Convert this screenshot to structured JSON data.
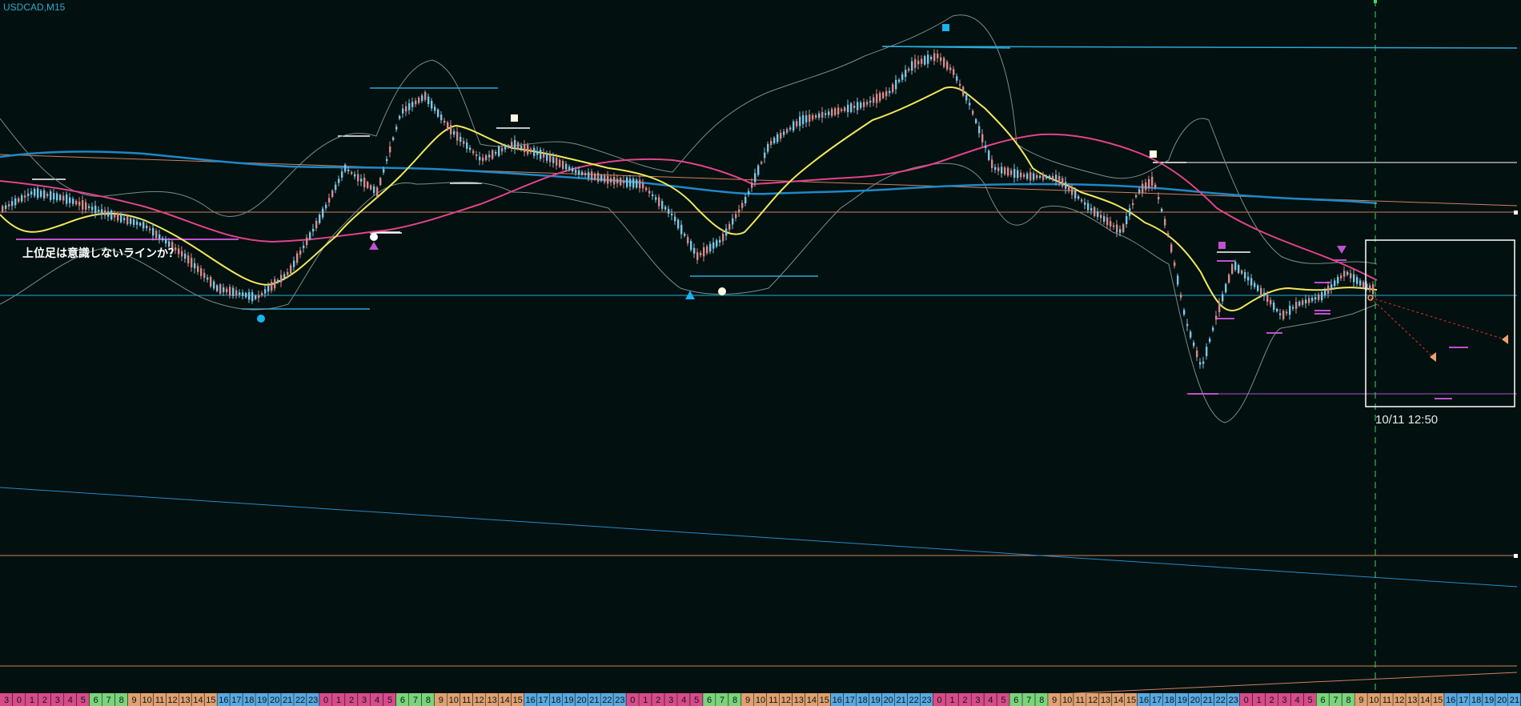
{
  "window": {
    "symbol_title": "USDCAD,M15"
  },
  "annotation": {
    "text": "上位足は意識しないラインか？"
  },
  "marker": {
    "timestamp": "10/11 12:50"
  },
  "colors": {
    "background": "#02100f",
    "candle_up": "#d88b8b",
    "candle_down": "#7ec6e6",
    "ma_fast": "#f2e85a",
    "ma_mid": "#e2448c",
    "ma_slow": "#1e88c8",
    "bands": "#7a8c8c",
    "hline_blue": "#2aa8d8",
    "hline_orange": "#d08060",
    "purple": "#b050d0",
    "white": "#ffffff"
  },
  "chart_data": {
    "type": "candlestick",
    "symbol": "USDCAD",
    "timeframe": "M15",
    "x_tick_labels": [
      "3",
      "0",
      "1",
      "2",
      "3",
      "4",
      "5",
      "6",
      "7",
      "8",
      "9",
      "10",
      "11",
      "12",
      "13",
      "14",
      "15",
      "16",
      "17",
      "18",
      "19",
      "20",
      "21",
      "22",
      "23",
      "0",
      "1",
      "2",
      "3",
      "4",
      "5",
      "6",
      "7",
      "8",
      "9",
      "10",
      "11",
      "12",
      "13",
      "14",
      "15",
      "16",
      "17",
      "18",
      "19",
      "20",
      "21",
      "22",
      "23",
      "0",
      "1",
      "2",
      "3",
      "4",
      "5",
      "6",
      "7",
      "8",
      "9",
      "10",
      "11",
      "12",
      "13",
      "14",
      "15",
      "16",
      "17",
      "18",
      "19",
      "20",
      "21",
      "22",
      "23",
      "0",
      "1",
      "2",
      "3",
      "4",
      "5",
      "6",
      "7",
      "8",
      "9",
      "10",
      "11",
      "12",
      "13",
      "14",
      "15",
      "16",
      "17",
      "18",
      "19",
      "20",
      "21",
      "22",
      "23",
      "0",
      "1",
      "2",
      "3",
      "4",
      "5",
      "6",
      "7",
      "8",
      "9",
      "10",
      "11",
      "12",
      "13",
      "14",
      "15",
      "16",
      "17",
      "18",
      "19",
      "20",
      "21"
    ],
    "x_tick_colors": [
      "#d84a8a",
      "#d84a8a",
      "#d84a8a",
      "#d84a8a",
      "#d84a8a",
      "#d84a8a",
      "#d84a8a",
      "#7ad47a",
      "#7ad47a",
      "#7ad47a",
      "#e0a070",
      "#e0a070",
      "#e0a070",
      "#e0a070",
      "#e0a070",
      "#e0a070",
      "#e0a070",
      "#5aa8e0",
      "#5aa8e0",
      "#5aa8e0",
      "#5aa8e0",
      "#5aa8e0",
      "#5aa8e0",
      "#5aa8e0",
      "#5aa8e0",
      "#d84a8a",
      "#d84a8a",
      "#d84a8a",
      "#d84a8a",
      "#d84a8a",
      "#d84a8a",
      "#7ad47a",
      "#7ad47a",
      "#7ad47a",
      "#e0a070",
      "#e0a070",
      "#e0a070",
      "#e0a070",
      "#e0a070",
      "#e0a070",
      "#e0a070",
      "#5aa8e0",
      "#5aa8e0",
      "#5aa8e0",
      "#5aa8e0",
      "#5aa8e0",
      "#5aa8e0",
      "#5aa8e0",
      "#5aa8e0",
      "#d84a8a",
      "#d84a8a",
      "#d84a8a",
      "#d84a8a",
      "#d84a8a",
      "#d84a8a",
      "#7ad47a",
      "#7ad47a",
      "#7ad47a",
      "#e0a070",
      "#e0a070",
      "#e0a070",
      "#e0a070",
      "#e0a070",
      "#e0a070",
      "#e0a070",
      "#5aa8e0",
      "#5aa8e0",
      "#5aa8e0",
      "#5aa8e0",
      "#5aa8e0",
      "#5aa8e0",
      "#5aa8e0",
      "#5aa8e0",
      "#d84a8a",
      "#d84a8a",
      "#d84a8a",
      "#d84a8a",
      "#d84a8a",
      "#d84a8a",
      "#7ad47a",
      "#7ad47a",
      "#7ad47a",
      "#e0a070",
      "#e0a070",
      "#e0a070",
      "#e0a070",
      "#e0a070",
      "#e0a070",
      "#e0a070",
      "#5aa8e0",
      "#5aa8e0",
      "#5aa8e0",
      "#5aa8e0",
      "#5aa8e0",
      "#5aa8e0",
      "#5aa8e0",
      "#5aa8e0",
      "#d84a8a",
      "#d84a8a",
      "#d84a8a",
      "#d84a8a",
      "#d84a8a",
      "#d84a8a",
      "#7ad47a",
      "#7ad47a",
      "#7ad47a",
      "#e0a070",
      "#e0a070",
      "#e0a070",
      "#e0a070",
      "#e0a070",
      "#e0a070",
      "#e0a070",
      "#5aa8e0",
      "#5aa8e0",
      "#5aa8e0",
      "#5aa8e0",
      "#5aa8e0",
      "#5aa8e0",
      "#5aa8e0"
    ],
    "y_range": [
      0,
      1
    ],
    "grid": false,
    "legend": "none"
  }
}
